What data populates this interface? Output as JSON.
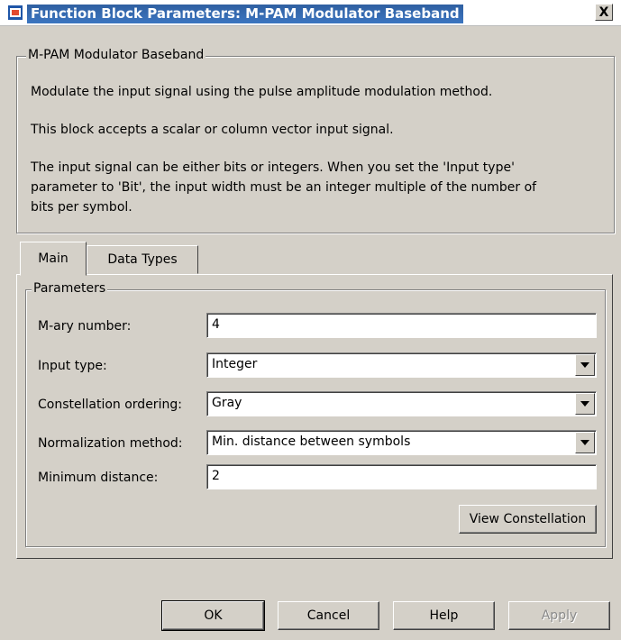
{
  "window": {
    "title": "Function Block Parameters: M-PAM Modulator Baseband",
    "close_label": "X"
  },
  "block": {
    "name": "M-PAM Modulator Baseband",
    "desc1": "Modulate the input signal using the pulse amplitude modulation method.",
    "desc2": "This block accepts a scalar or column vector input signal.",
    "desc3_line1": "The input signal can be either bits or integers. When you set the 'Input type'",
    "desc3_line2": "parameter to 'Bit', the input width must be an integer multiple of the number of",
    "desc3_line3": "bits per symbol."
  },
  "tabs": {
    "main": "Main",
    "data_types": "Data Types"
  },
  "parameters": {
    "legend": "Parameters",
    "mary_label": "M-ary number:",
    "mary_value": "4",
    "input_type_label": "Input type:",
    "input_type_value": "Integer",
    "constellation_label": "Constellation ordering:",
    "constellation_value": "Gray",
    "normalization_label": "Normalization method:",
    "normalization_value": "Min. distance between symbols",
    "min_distance_label": "Minimum distance:",
    "min_distance_value": "2",
    "view_constellation": "View Constellation"
  },
  "buttons": {
    "ok": "OK",
    "cancel": "Cancel",
    "help": "Help",
    "apply": "Apply"
  }
}
